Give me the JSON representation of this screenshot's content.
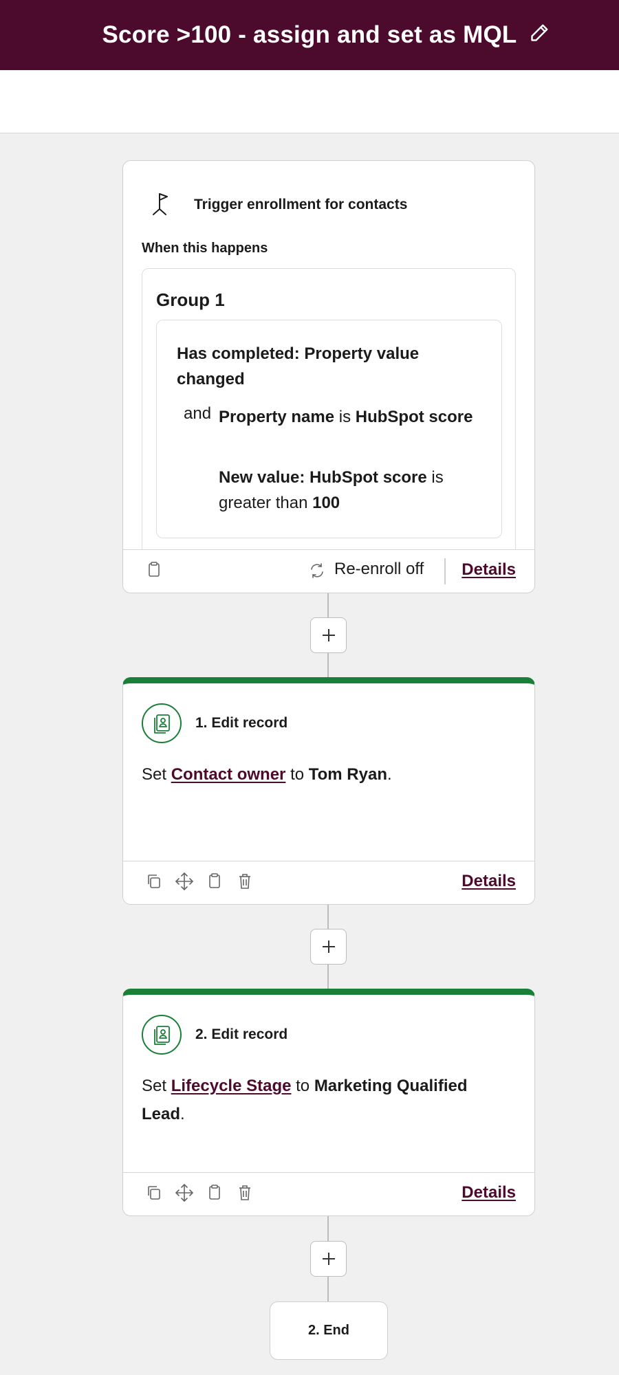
{
  "header": {
    "title": "Score >100 - assign and set as MQL",
    "edit_icon": "pencil-icon"
  },
  "trigger": {
    "title": "Trigger enrollment for contacts",
    "when_label": "When this happens",
    "group_title": "Group 1",
    "condition_main": "Has completed: Property value changed",
    "and_word": "and",
    "prop_name_label": "Property name",
    "is_word": "is",
    "prop_value": "HubSpot score",
    "new_value_label": "New value: HubSpot score",
    "new_is": "is",
    "new_op": "greater than",
    "new_threshold": "100",
    "reenroll": "Re-enroll off",
    "details": "Details"
  },
  "actions": [
    {
      "title": "1. Edit record",
      "set_word": "Set",
      "property": "Contact owner",
      "to_word": "to",
      "value": "Tom Ryan",
      "suffix": ".",
      "details": "Details"
    },
    {
      "title": "2. Edit record",
      "set_word": "Set",
      "property": "Lifecycle Stage",
      "to_word": "to",
      "value": "Marketing Qualified Lead",
      "suffix": ".",
      "details": "Details"
    }
  ],
  "end": {
    "label": "2. End"
  },
  "colors": {
    "header_bg": "#4c0a2c",
    "accent_green": "#1a7f37",
    "link": "#4c0a2c",
    "canvas_bg": "#f0f0f0"
  }
}
